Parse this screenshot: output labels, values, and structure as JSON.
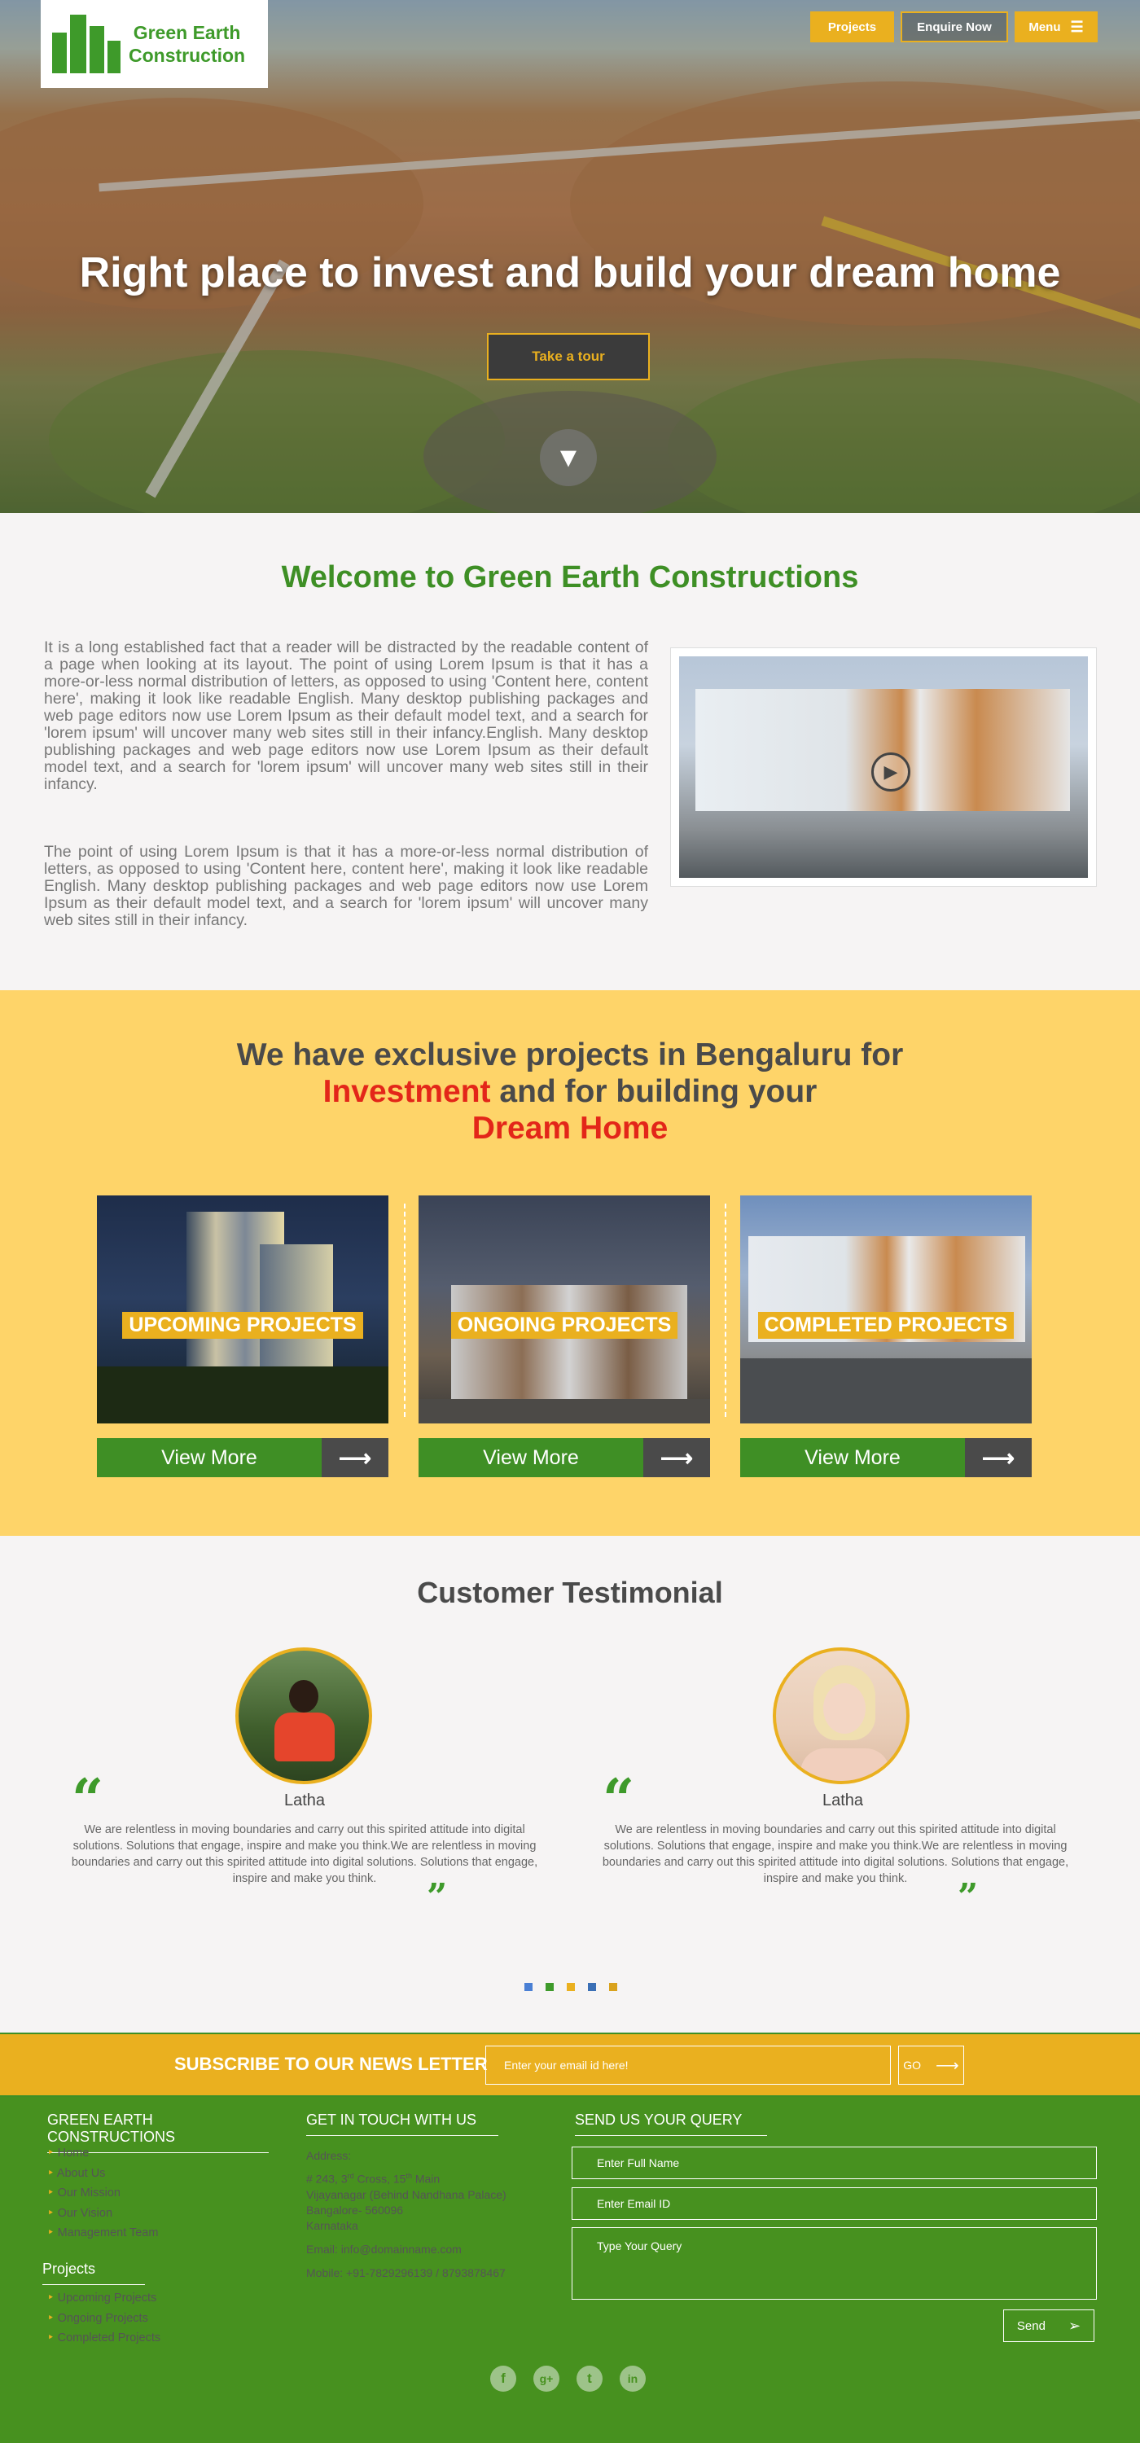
{
  "brand": {
    "name_line1": "Green Earth",
    "name_line2": "Construction"
  },
  "nav": {
    "projects": "Projects",
    "enquire": "Enquire Now",
    "menu": "Menu"
  },
  "hero": {
    "title": "Right place to invest and build your dream home",
    "cta": "Take a tour"
  },
  "welcome": {
    "title": "Welcome to Green Earth Constructions",
    "p1": "It is a long established fact that a reader will be distracted by the readable content of a page when looking at its layout. The point of using Lorem Ipsum is that it has a more-or-less normal distribution of letters, as opposed to using 'Content here, content here', making it look like readable English. Many desktop publishing packages and web page editors now use Lorem Ipsum as their default model text, and a search for 'lorem ipsum' will uncover many web sites still in their infancy.English. Many desktop publishing packages and web page editors now use Lorem Ipsum as their default model text, and a search for 'lorem ipsum' will uncover many web sites still in their infancy.",
    "p2": "The point of using Lorem Ipsum is that it has a more-or-less normal distribution of letters, as opposed to using 'Content here, content here', making it look like readable English. Many desktop publishing packages and web page editors now use Lorem Ipsum as their default model text, and a search for 'lorem ipsum' will uncover many web sites still in their infancy."
  },
  "projects": {
    "heading_line1": "We have exclusive projects in Bengaluru for",
    "heading_red1": "Investment",
    "heading_line2_rest": "and for building your",
    "heading_red2": "Dream Home",
    "cards": [
      {
        "tag": "UPCOMING PROJECTS",
        "button": "View More"
      },
      {
        "tag": "ONGOING PROJECTS",
        "button": "View More"
      },
      {
        "tag": "COMPLETED PROJECTS",
        "button": "View More"
      }
    ]
  },
  "testimonial": {
    "title": "Customer Testimonial",
    "items": [
      {
        "name": "Latha",
        "text": "We are relentless in moving boundaries and carry out this spirited attitude into digital solutions. Solutions that engage, inspire and make you think.We are relentless in moving boundaries and carry out this spirited attitude into digital solutions. Solutions that engage, inspire and make you think."
      },
      {
        "name": "Latha",
        "text": "We are relentless in moving boundaries and carry out this spirited attitude into digital solutions. Solutions that engage, inspire and make you think.We are relentless in moving boundaries and carry out this spirited attitude into digital solutions. Solutions that engage, inspire and make you think."
      }
    ],
    "dot_colors": [
      "#4a7fd4",
      "#3e9a2a",
      "#eab01f",
      "#3b6fb5",
      "#d9a21d"
    ]
  },
  "subscribe": {
    "label": "SUBSCRIBE TO OUR NEWS LETTER",
    "placeholder": "Enter your email id here!",
    "go": "GO"
  },
  "footer": {
    "col1_title": "GREEN EARTH CONSTRUCTIONS",
    "links": [
      "Home",
      "About Us",
      "Our Mission",
      "Our Vision",
      "Management Team"
    ],
    "projects_title": "Projects",
    "project_links": [
      "Upcoming Projects",
      "Ongoing Projects",
      "Completed Projects"
    ],
    "col2_title": "GET IN TOUCH WITH US",
    "address_label": "Address:",
    "address_l1": "# 243, 3",
    "address_l1_sup1": "rd",
    "address_l1_mid": " Cross, 15",
    "address_l1_sup2": "th",
    "address_l1_end": " Main",
    "address_l2": "Vijayanagar (Behind Nandhana Palace)",
    "address_l3": "Bangalore- 560096",
    "address_l4": "Karnataka",
    "email": "Email: info@domainname.com",
    "mobile": "Mobile: +91-7829296139 / 8793878467",
    "col3_title": "SEND US YOUR QUERY",
    "name_ph": "Enter Full Name",
    "email_ph": "Enter Email ID",
    "query_ph": "Type Your Query",
    "send": "Send",
    "social": [
      "f",
      "g+",
      "t",
      "in"
    ]
  },
  "colors": {
    "brand_green": "#3e9a2a",
    "accent_yellow": "#eab01f",
    "footer_green": "#47911f",
    "highlight_red": "#e32619"
  }
}
